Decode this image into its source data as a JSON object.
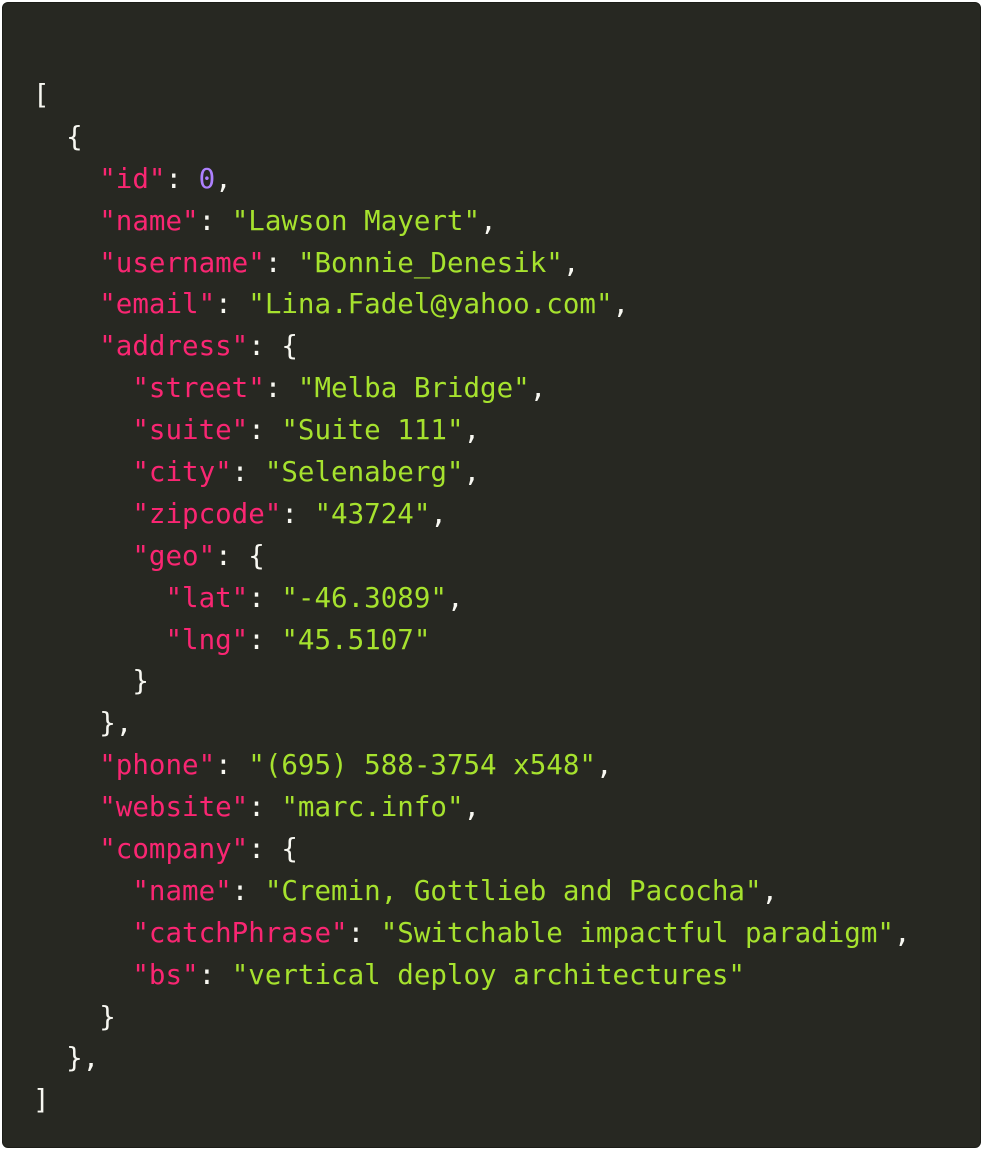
{
  "colors": {
    "background": "#272822",
    "punctuation": "#f8f8f2",
    "key": "#f92672",
    "string": "#a6e22e",
    "number": "#ae81ff"
  },
  "lines": [
    [
      {
        "t": "pun",
        "v": "["
      }
    ],
    [
      {
        "t": "pun",
        "v": "  {"
      }
    ],
    [
      {
        "t": "pun",
        "v": "    "
      },
      {
        "t": "key",
        "v": "\"id\""
      },
      {
        "t": "pun",
        "v": ": "
      },
      {
        "t": "num",
        "v": "0"
      },
      {
        "t": "pun",
        "v": ","
      }
    ],
    [
      {
        "t": "pun",
        "v": "    "
      },
      {
        "t": "key",
        "v": "\"name\""
      },
      {
        "t": "pun",
        "v": ": "
      },
      {
        "t": "str",
        "v": "\"Lawson Mayert\""
      },
      {
        "t": "pun",
        "v": ","
      }
    ],
    [
      {
        "t": "pun",
        "v": "    "
      },
      {
        "t": "key",
        "v": "\"username\""
      },
      {
        "t": "pun",
        "v": ": "
      },
      {
        "t": "str",
        "v": "\"Bonnie_Denesik\""
      },
      {
        "t": "pun",
        "v": ","
      }
    ],
    [
      {
        "t": "pun",
        "v": "    "
      },
      {
        "t": "key",
        "v": "\"email\""
      },
      {
        "t": "pun",
        "v": ": "
      },
      {
        "t": "str",
        "v": "\"Lina.Fadel@yahoo.com\""
      },
      {
        "t": "pun",
        "v": ","
      }
    ],
    [
      {
        "t": "pun",
        "v": "    "
      },
      {
        "t": "key",
        "v": "\"address\""
      },
      {
        "t": "pun",
        "v": ": {"
      }
    ],
    [
      {
        "t": "pun",
        "v": "      "
      },
      {
        "t": "key",
        "v": "\"street\""
      },
      {
        "t": "pun",
        "v": ": "
      },
      {
        "t": "str",
        "v": "\"Melba Bridge\""
      },
      {
        "t": "pun",
        "v": ","
      }
    ],
    [
      {
        "t": "pun",
        "v": "      "
      },
      {
        "t": "key",
        "v": "\"suite\""
      },
      {
        "t": "pun",
        "v": ": "
      },
      {
        "t": "str",
        "v": "\"Suite 111\""
      },
      {
        "t": "pun",
        "v": ","
      }
    ],
    [
      {
        "t": "pun",
        "v": "      "
      },
      {
        "t": "key",
        "v": "\"city\""
      },
      {
        "t": "pun",
        "v": ": "
      },
      {
        "t": "str",
        "v": "\"Selenaberg\""
      },
      {
        "t": "pun",
        "v": ","
      }
    ],
    [
      {
        "t": "pun",
        "v": "      "
      },
      {
        "t": "key",
        "v": "\"zipcode\""
      },
      {
        "t": "pun",
        "v": ": "
      },
      {
        "t": "str",
        "v": "\"43724\""
      },
      {
        "t": "pun",
        "v": ","
      }
    ],
    [
      {
        "t": "pun",
        "v": "      "
      },
      {
        "t": "key",
        "v": "\"geo\""
      },
      {
        "t": "pun",
        "v": ": {"
      }
    ],
    [
      {
        "t": "pun",
        "v": "        "
      },
      {
        "t": "key",
        "v": "\"lat\""
      },
      {
        "t": "pun",
        "v": ": "
      },
      {
        "t": "str",
        "v": "\"-46.3089\""
      },
      {
        "t": "pun",
        "v": ","
      }
    ],
    [
      {
        "t": "pun",
        "v": "        "
      },
      {
        "t": "key",
        "v": "\"lng\""
      },
      {
        "t": "pun",
        "v": ": "
      },
      {
        "t": "str",
        "v": "\"45.5107\""
      }
    ],
    [
      {
        "t": "pun",
        "v": "      }"
      }
    ],
    [
      {
        "t": "pun",
        "v": "    },"
      }
    ],
    [
      {
        "t": "pun",
        "v": "    "
      },
      {
        "t": "key",
        "v": "\"phone\""
      },
      {
        "t": "pun",
        "v": ": "
      },
      {
        "t": "str",
        "v": "\"(695) 588-3754 x548\""
      },
      {
        "t": "pun",
        "v": ","
      }
    ],
    [
      {
        "t": "pun",
        "v": "    "
      },
      {
        "t": "key",
        "v": "\"website\""
      },
      {
        "t": "pun",
        "v": ": "
      },
      {
        "t": "str",
        "v": "\"marc.info\""
      },
      {
        "t": "pun",
        "v": ","
      }
    ],
    [
      {
        "t": "pun",
        "v": "    "
      },
      {
        "t": "key",
        "v": "\"company\""
      },
      {
        "t": "pun",
        "v": ": {"
      }
    ],
    [
      {
        "t": "pun",
        "v": "      "
      },
      {
        "t": "key",
        "v": "\"name\""
      },
      {
        "t": "pun",
        "v": ": "
      },
      {
        "t": "str",
        "v": "\"Cremin, Gottlieb and Pacocha\""
      },
      {
        "t": "pun",
        "v": ","
      }
    ],
    [
      {
        "t": "pun",
        "v": "      "
      },
      {
        "t": "key",
        "v": "\"catchPhrase\""
      },
      {
        "t": "pun",
        "v": ": "
      },
      {
        "t": "str",
        "v": "\"Switchable impactful paradigm\""
      },
      {
        "t": "pun",
        "v": ","
      }
    ],
    [
      {
        "t": "pun",
        "v": "      "
      },
      {
        "t": "key",
        "v": "\"bs\""
      },
      {
        "t": "pun",
        "v": ": "
      },
      {
        "t": "str",
        "v": "\"vertical deploy architectures\""
      }
    ],
    [
      {
        "t": "pun",
        "v": "    }"
      }
    ],
    [
      {
        "t": "pun",
        "v": "  },"
      }
    ],
    [
      {
        "t": "pun",
        "v": "]"
      }
    ]
  ]
}
